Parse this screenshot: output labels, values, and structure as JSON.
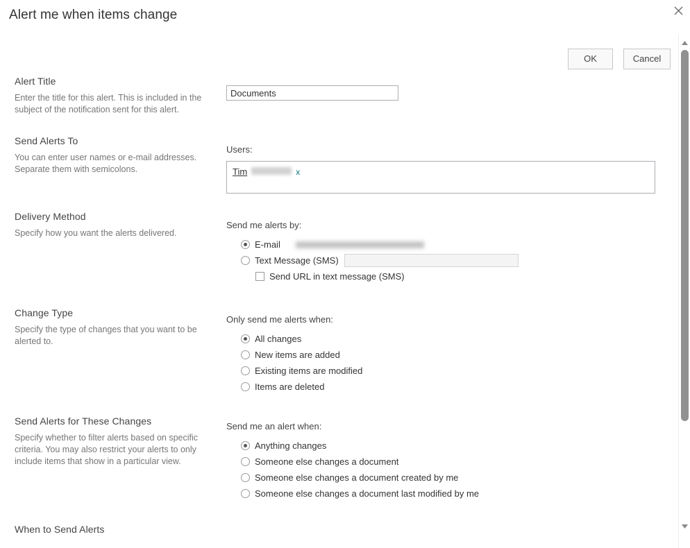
{
  "dialog": {
    "title": "Alert me when items change",
    "close_icon": "close-icon"
  },
  "actions": {
    "ok_label": "OK",
    "cancel_label": "Cancel"
  },
  "sections": {
    "alert_title": {
      "heading": "Alert Title",
      "description": "Enter the title for this alert. This is included in the subject of the notification sent for this alert.",
      "input_value": "Documents",
      "input_placeholder": ""
    },
    "send_alerts_to": {
      "heading": "Send Alerts To",
      "description": "You can enter user names or e-mail addresses. Separate them with semicolons.",
      "field_label": "Users:",
      "person_name": "Tim",
      "person_surname_redacted": "",
      "remove_label": "x"
    },
    "delivery_method": {
      "heading": "Delivery Method",
      "description": "Specify how you want the alerts delivered.",
      "field_label": "Send me alerts by:",
      "options": [
        {
          "label": "E-mail",
          "selected": true
        },
        {
          "label": "Text Message (SMS)",
          "selected": false
        }
      ],
      "email_value_redacted": "",
      "sms_value": "",
      "send_url_checkbox": {
        "label": "Send URL in text message (SMS)",
        "checked": false
      }
    },
    "change_type": {
      "heading": "Change Type",
      "description": "Specify the type of changes that you want to be alerted to.",
      "field_label": "Only send me alerts when:",
      "options": [
        {
          "label": "All changes",
          "selected": true
        },
        {
          "label": "New items are added",
          "selected": false
        },
        {
          "label": "Existing items are modified",
          "selected": false
        },
        {
          "label": "Items are deleted",
          "selected": false
        }
      ]
    },
    "send_alerts_for_changes": {
      "heading": "Send Alerts for These Changes",
      "description": "Specify whether to filter alerts based on specific criteria. You may also restrict your alerts to only include items that show in a particular view.",
      "field_label": "Send me an alert when:",
      "options": [
        {
          "label": "Anything changes",
          "selected": true
        },
        {
          "label": "Someone else changes a document",
          "selected": false
        },
        {
          "label": "Someone else changes a document created by me",
          "selected": false
        },
        {
          "label": "Someone else changes a document last modified by me",
          "selected": false
        }
      ]
    },
    "when_to_send": {
      "heading": "When to Send Alerts"
    }
  },
  "scrollbar": {
    "up_icon": "chevron-up-icon",
    "down_icon": "chevron-down-icon"
  },
  "colors": {
    "accent": "#0f7c86",
    "text": "#333333",
    "muted": "#767676"
  }
}
